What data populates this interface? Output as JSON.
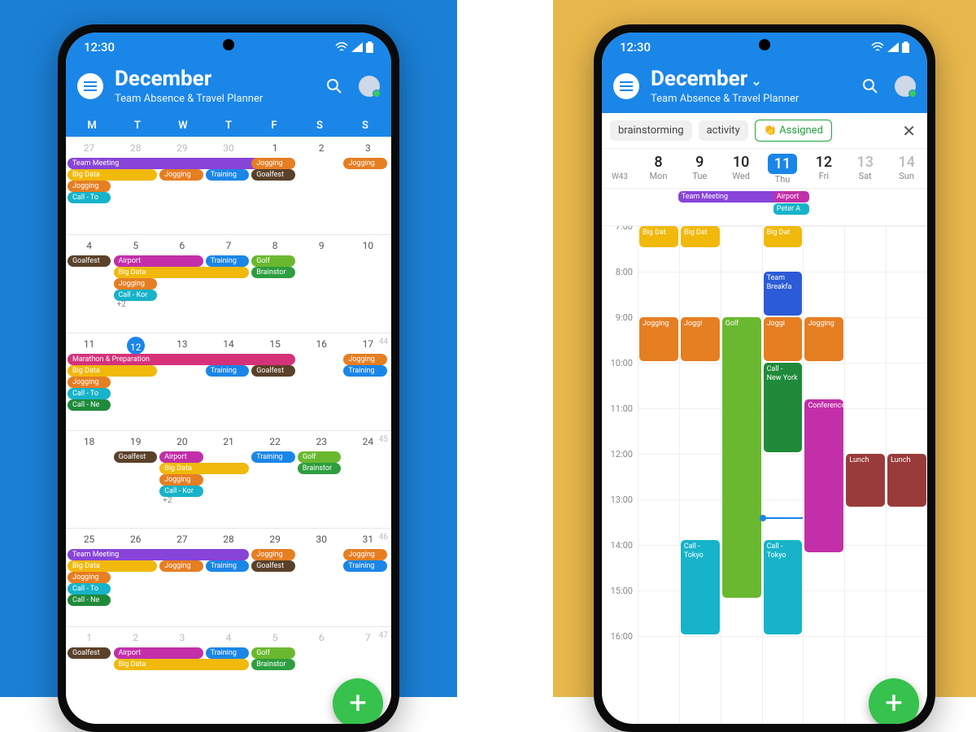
{
  "status": {
    "time": "12:30"
  },
  "header": {
    "title": "December",
    "subtitle": "Team Absence & Travel Planner",
    "show_chevron_right": true
  },
  "dow": [
    "M",
    "T",
    "W",
    "T",
    "F",
    "S",
    "S"
  ],
  "colors": {
    "purple": "#8844d8",
    "orange": "#e67e22",
    "blue": "#1a86e8",
    "yellow": "#f1b90c",
    "teal": "#17b3c9",
    "green": "#2e9e3f",
    "brown": "#7d5a3a",
    "dkbrown": "#5a412a",
    "pink": "#d6327a",
    "magenta": "#c22fa8",
    "lime": "#6ab82f",
    "dkgreen": "#1f8a3a",
    "maroon": "#9a3b3b",
    "navy": "#2b5bd6"
  },
  "month": {
    "weeks": [
      {
        "wk": "",
        "days": [
          {
            "n": "27",
            "f": true
          },
          {
            "n": "28",
            "f": true
          },
          {
            "n": "29",
            "f": true
          },
          {
            "n": "30",
            "f": true
          },
          {
            "n": "1"
          },
          {
            "n": "2"
          },
          {
            "n": "3"
          }
        ],
        "rows": [
          [
            {
              "t": "Team Meeting",
              "c": "purple",
              "s": 0,
              "e": 4
            },
            {
              "t": "Jogging",
              "c": "orange",
              "s": 4,
              "e": 4
            },
            {
              "t": "Jogging",
              "c": "orange",
              "s": 6,
              "e": 6
            }
          ],
          [
            {
              "t": "Big Data",
              "c": "yellow",
              "s": 0,
              "e": 1
            },
            {
              "t": "Jogging",
              "c": "orange",
              "s": 2,
              "e": 2
            },
            {
              "t": "Training",
              "c": "blue",
              "s": 3,
              "e": 3
            },
            {
              "t": "Goalfest",
              "c": "dkbrown",
              "s": 4,
              "e": 4
            }
          ],
          [
            {
              "t": "Jogging",
              "c": "orange",
              "s": 0,
              "e": 0
            }
          ],
          [
            {
              "t": "Call - To",
              "c": "teal",
              "s": 0,
              "e": 0
            }
          ]
        ]
      },
      {
        "wk": "",
        "days": [
          {
            "n": "4"
          },
          {
            "n": "5"
          },
          {
            "n": "6"
          },
          {
            "n": "7"
          },
          {
            "n": "8"
          },
          {
            "n": "9"
          },
          {
            "n": "10"
          }
        ],
        "rows": [
          [
            {
              "t": "Goalfest",
              "c": "dkbrown",
              "s": 0,
              "e": 0
            },
            {
              "t": "Airport",
              "c": "magenta",
              "s": 1,
              "e": 2
            },
            {
              "t": "Training",
              "c": "blue",
              "s": 3,
              "e": 3
            },
            {
              "t": "Golf",
              "c": "lime",
              "s": 4,
              "e": 4
            }
          ],
          [
            {
              "t": "Big Data",
              "c": "yellow",
              "s": 1,
              "e": 3
            },
            {
              "t": "Brainstor",
              "c": "green",
              "s": 4,
              "e": 4
            }
          ],
          [
            {
              "t": "Jogging",
              "c": "orange",
              "s": 1,
              "e": 1
            }
          ],
          [
            {
              "t": "Call - Kor",
              "c": "teal",
              "s": 1,
              "e": 1
            }
          ]
        ],
        "more": {
          "col": 1,
          "t": "+2"
        }
      },
      {
        "wk": "44",
        "days": [
          {
            "n": "11"
          },
          {
            "n": "12",
            "today": true
          },
          {
            "n": "13"
          },
          {
            "n": "14"
          },
          {
            "n": "15"
          },
          {
            "n": "16"
          },
          {
            "n": "17"
          }
        ],
        "rows": [
          [
            {
              "t": "Marathon & Preparation",
              "c": "pink",
              "s": 0,
              "e": 4
            },
            {
              "t": "Jogging",
              "c": "orange",
              "s": 6,
              "e": 6
            }
          ],
          [
            {
              "t": "Big Data",
              "c": "yellow",
              "s": 0,
              "e": 1
            },
            {
              "t": "Training",
              "c": "blue",
              "s": 3,
              "e": 3
            },
            {
              "t": "Goalfest",
              "c": "dkbrown",
              "s": 4,
              "e": 4
            },
            {
              "t": "Training",
              "c": "blue",
              "s": 6,
              "e": 6
            }
          ],
          [
            {
              "t": "Jogging",
              "c": "orange",
              "s": 0,
              "e": 0
            }
          ],
          [
            {
              "t": "Call - To",
              "c": "teal",
              "s": 0,
              "e": 0
            }
          ],
          [
            {
              "t": "Call - Ne",
              "c": "dkgreen",
              "s": 0,
              "e": 0
            }
          ]
        ]
      },
      {
        "wk": "45",
        "days": [
          {
            "n": "18"
          },
          {
            "n": "19"
          },
          {
            "n": "20"
          },
          {
            "n": "21"
          },
          {
            "n": "22"
          },
          {
            "n": "23"
          },
          {
            "n": "24"
          }
        ],
        "rows": [
          [
            {
              "t": "Goalfest",
              "c": "dkbrown",
              "s": 1,
              "e": 1
            },
            {
              "t": "Airport",
              "c": "magenta",
              "s": 2,
              "e": 2
            },
            {
              "t": "Training",
              "c": "blue",
              "s": 4,
              "e": 4
            },
            {
              "t": "Golf",
              "c": "lime",
              "s": 5,
              "e": 5
            }
          ],
          [
            {
              "t": "Big Data",
              "c": "yellow",
              "s": 2,
              "e": 3
            },
            {
              "t": "Brainstor",
              "c": "green",
              "s": 5,
              "e": 5
            }
          ],
          [
            {
              "t": "Jogging",
              "c": "orange",
              "s": 2,
              "e": 2
            }
          ],
          [
            {
              "t": "Call - Kor",
              "c": "teal",
              "s": 2,
              "e": 2
            }
          ]
        ],
        "more": {
          "col": 2,
          "t": "+2"
        }
      },
      {
        "wk": "46",
        "days": [
          {
            "n": "25"
          },
          {
            "n": "26"
          },
          {
            "n": "27"
          },
          {
            "n": "28"
          },
          {
            "n": "29"
          },
          {
            "n": "30"
          },
          {
            "n": "31"
          }
        ],
        "rows": [
          [
            {
              "t": "Team Meeting",
              "c": "purple",
              "s": 0,
              "e": 3
            },
            {
              "t": "Jogging",
              "c": "orange",
              "s": 4,
              "e": 4
            },
            {
              "t": "Jogging",
              "c": "orange",
              "s": 6,
              "e": 6
            }
          ],
          [
            {
              "t": "Big Data",
              "c": "yellow",
              "s": 0,
              "e": 1
            },
            {
              "t": "Jogging",
              "c": "orange",
              "s": 2,
              "e": 2
            },
            {
              "t": "Training",
              "c": "blue",
              "s": 3,
              "e": 3
            },
            {
              "t": "Goalfest",
              "c": "dkbrown",
              "s": 4,
              "e": 4
            },
            {
              "t": "Training",
              "c": "blue",
              "s": 6,
              "e": 6
            }
          ],
          [
            {
              "t": "Jogging",
              "c": "orange",
              "s": 0,
              "e": 0
            }
          ],
          [
            {
              "t": "Call - To",
              "c": "teal",
              "s": 0,
              "e": 0
            }
          ],
          [
            {
              "t": "Call - Ne",
              "c": "dkgreen",
              "s": 0,
              "e": 0
            }
          ]
        ]
      },
      {
        "wk": "47",
        "days": [
          {
            "n": "1",
            "f": true
          },
          {
            "n": "2",
            "f": true
          },
          {
            "n": "3",
            "f": true
          },
          {
            "n": "4",
            "f": true
          },
          {
            "n": "5",
            "f": true
          },
          {
            "n": "6",
            "f": true
          },
          {
            "n": "7",
            "f": true
          }
        ],
        "rows": [
          [
            {
              "t": "Goalfest",
              "c": "dkbrown",
              "s": 0,
              "e": 0
            },
            {
              "t": "Airport",
              "c": "magenta",
              "s": 1,
              "e": 2
            },
            {
              "t": "Training",
              "c": "blue",
              "s": 3,
              "e": 3
            },
            {
              "t": "Golf",
              "c": "lime",
              "s": 4,
              "e": 4
            }
          ],
          [
            {
              "t": "Big Data",
              "c": "yellow",
              "s": 1,
              "e": 3
            },
            {
              "t": "Brainstor",
              "c": "green",
              "s": 4,
              "e": 4
            }
          ]
        ]
      }
    ]
  },
  "filters": {
    "chips": [
      {
        "t": "brainstorming"
      },
      {
        "t": "activity"
      },
      {
        "t": "👏 Assigned",
        "asg": true
      }
    ]
  },
  "weekview": {
    "wk": "W43",
    "days": [
      {
        "n": "8",
        "d": "Mon"
      },
      {
        "n": "9",
        "d": "Tue"
      },
      {
        "n": "10",
        "d": "Wed"
      },
      {
        "n": "11",
        "d": "Thu",
        "today": true
      },
      {
        "n": "12",
        "d": "Fri"
      },
      {
        "n": "13",
        "d": "Sat",
        "w": true
      },
      {
        "n": "14",
        "d": "Sun",
        "w": true
      }
    ],
    "allday": [
      [],
      [
        {
          "t": "Team Meeting",
          "c": "purple",
          "span": 2
        }
      ],
      [],
      [
        {
          "t": "Airport",
          "c": "magenta"
        },
        {
          "t": "Peter A",
          "c": "teal"
        }
      ],
      [],
      [],
      []
    ],
    "hours": [
      "7:00",
      "8:00",
      "9:00",
      "10:00",
      "11:00",
      "12:00",
      "13:00",
      "14:00",
      "15:00",
      "16:00"
    ],
    "startHour": 7,
    "hourH": 56,
    "nowHour": 13.4,
    "nowCol": 3,
    "events": [
      {
        "col": 0,
        "t": "Big Dat",
        "c": "yellow",
        "s": 7.0,
        "e": 7.5
      },
      {
        "col": 1,
        "t": "Big Dat",
        "c": "yellow",
        "s": 7.0,
        "e": 7.5
      },
      {
        "col": 3,
        "t": "Big Dat",
        "c": "yellow",
        "s": 7.0,
        "e": 7.5
      },
      {
        "col": 3,
        "t": "Team Breakfa",
        "c": "navy",
        "s": 8.0,
        "e": 9.0
      },
      {
        "col": 0,
        "t": "Jogging",
        "c": "orange",
        "s": 9.0,
        "e": 10.0
      },
      {
        "col": 1,
        "t": "Joggi",
        "c": "orange",
        "s": 9.0,
        "e": 10.0
      },
      {
        "col": 2,
        "t": "Golf",
        "c": "lime",
        "s": 9.0,
        "e": 15.2
      },
      {
        "col": 3,
        "t": "Joggi",
        "c": "orange",
        "s": 9.0,
        "e": 10.0
      },
      {
        "col": 4,
        "t": "Jogging",
        "c": "orange",
        "s": 9.0,
        "e": 10.0
      },
      {
        "col": 3,
        "t": "Call - New York",
        "c": "dkgreen",
        "s": 10.0,
        "e": 12.0
      },
      {
        "col": 4,
        "t": "Conference",
        "c": "magenta",
        "s": 10.8,
        "e": 14.2
      },
      {
        "col": 5,
        "t": "Lunch",
        "c": "maroon",
        "s": 12.0,
        "e": 13.2
      },
      {
        "col": 6,
        "t": "Lunch",
        "c": "maroon",
        "s": 12.0,
        "e": 13.2
      },
      {
        "col": 1,
        "t": "Call - Tokyo",
        "c": "teal",
        "s": 13.9,
        "e": 16.0
      },
      {
        "col": 3,
        "t": "Call - Tokyo",
        "c": "teal",
        "s": 13.9,
        "e": 16.0
      }
    ]
  }
}
